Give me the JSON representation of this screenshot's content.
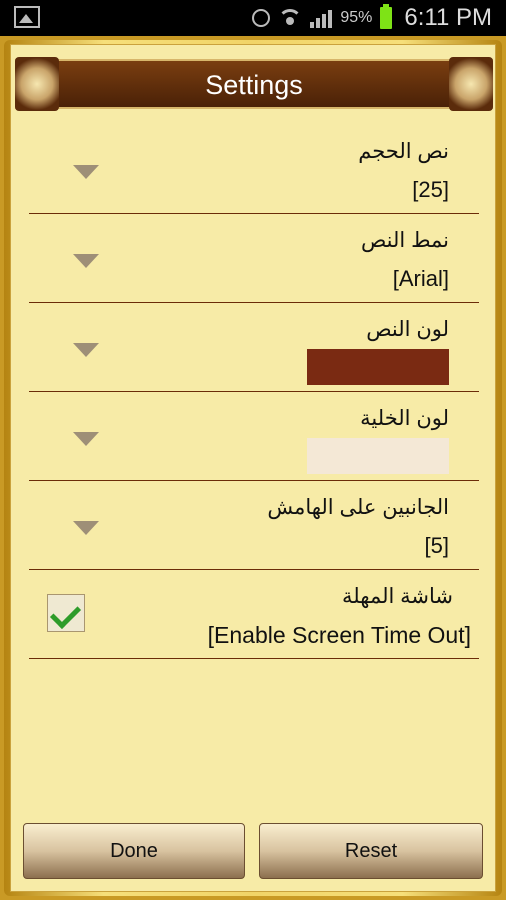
{
  "status": {
    "battery_pct": "95%",
    "time": "6:11 PM"
  },
  "title": "Settings",
  "settings": [
    {
      "label": "نص الحجم",
      "value": "[25]"
    },
    {
      "label": "نمط النص",
      "value": "[Arial]"
    },
    {
      "label": "لون النص",
      "swatch": "#7a2a12"
    },
    {
      "label": "لون الخلية",
      "swatch": "#f4e8d6"
    },
    {
      "label": "الجانبين على الهامش",
      "value": "[5]"
    },
    {
      "label": "شاشة المهلة",
      "value": "[Enable Screen Time Out]",
      "checked": true
    }
  ],
  "buttons": {
    "done": "Done",
    "reset": "Reset"
  }
}
